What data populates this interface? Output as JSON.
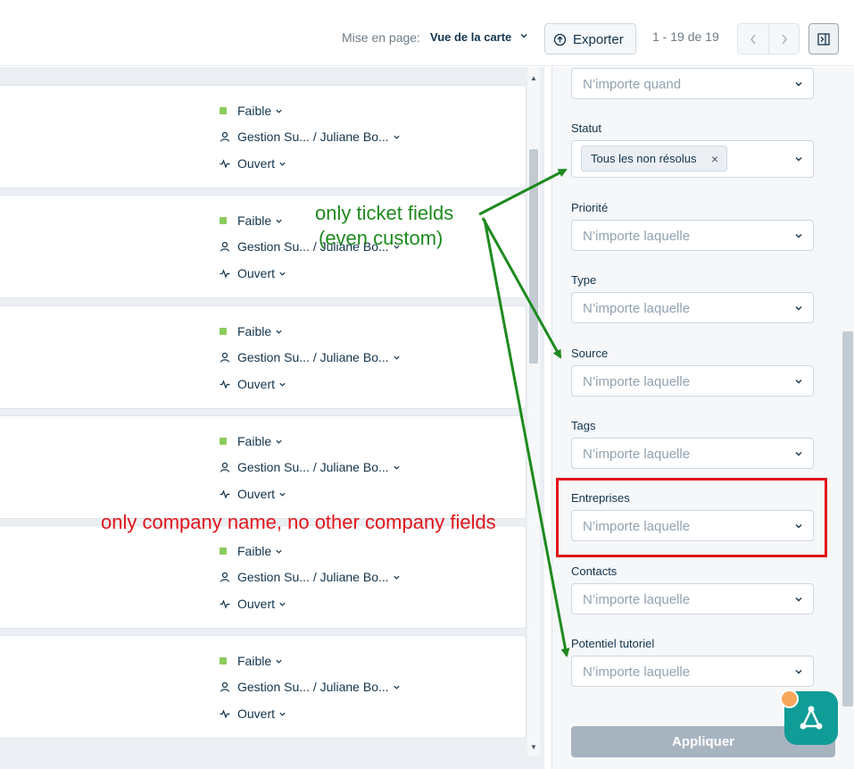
{
  "toolbar": {
    "layout_label": "Mise en page:",
    "layout_value": "Vue de la carte",
    "export_label": "Exporter",
    "pagination": "1 - 19 de 19"
  },
  "cards": [
    {
      "priority": "Faible",
      "group": "Gestion Su... / Juliane Bo...",
      "status": "Ouvert"
    },
    {
      "priority": "Faible",
      "group": "Gestion Su... / Juliane Bo...",
      "status": "Ouvert"
    },
    {
      "priority": "Faible",
      "group": "Gestion Su... / Juliane Bo...",
      "status": "Ouvert"
    },
    {
      "priority": "Faible",
      "group": "Gestion Su... / Juliane Bo...",
      "status": "Ouvert"
    },
    {
      "priority": "Faible",
      "group": "Gestion Su... / Juliane Bo...",
      "status": "Ouvert"
    },
    {
      "priority": "Faible",
      "group": "Gestion Su... / Juliane Bo...",
      "status": "Ouvert"
    }
  ],
  "filters": {
    "date_placeholder": "N’importe quand",
    "status_label": "Statut",
    "status_chip": "Tous les non résolus",
    "priority_label": "Priorité",
    "priority_placeholder": "N’importe laquelle",
    "type_label": "Type",
    "type_placeholder": "N’importe laquelle",
    "source_label": "Source",
    "source_placeholder": "N’importe laquelle",
    "tags_label": "Tags",
    "tags_placeholder": "N’importe laquelle",
    "companies_label": "Entreprises",
    "companies_placeholder": "N’importe laquelle",
    "contacts_label": "Contacts",
    "contacts_placeholder": "N’importe laquelle",
    "tutorial_label": "Potentiel tutoriel",
    "tutorial_placeholder": "N’importe laquelle",
    "apply_label": "Appliquer"
  },
  "annotations": {
    "green_line1": "only ticket fields",
    "green_line2": "(even custom)",
    "red_text": "only company name, no other company fields"
  },
  "colors": {
    "priority_low": "#8ccb5d",
    "annotation_green": "#1e8a1e",
    "annotation_red": "#e3141a",
    "fab": "#109c97"
  }
}
